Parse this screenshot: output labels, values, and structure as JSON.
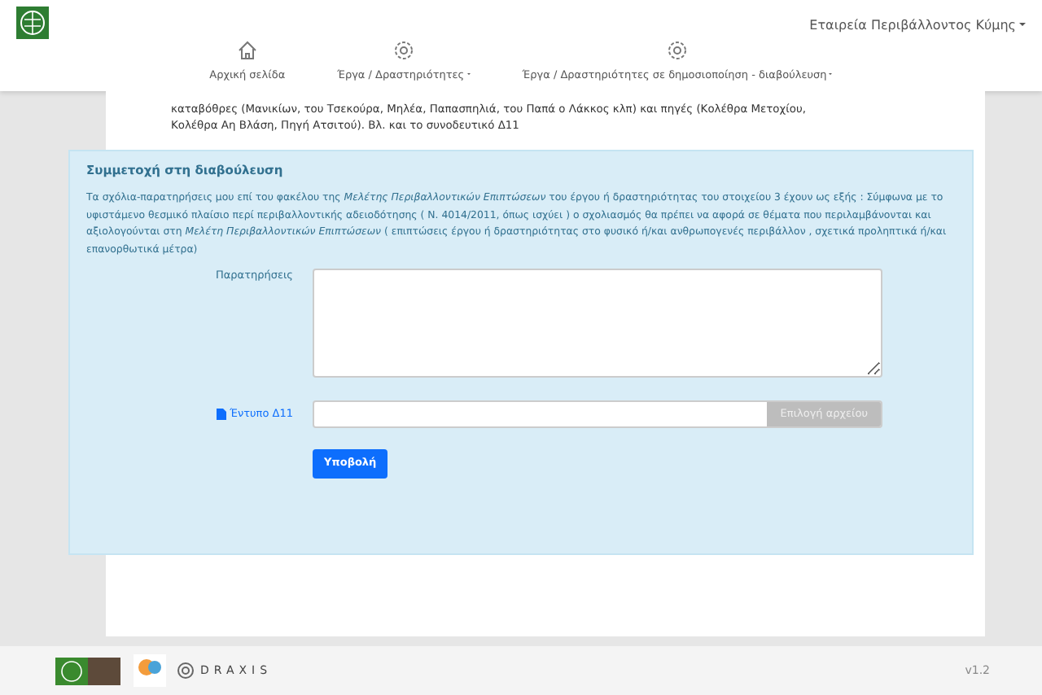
{
  "header": {
    "company_menu": "Εταιρεία Περιβάλλοντος Κύμης"
  },
  "nav": [
    {
      "label": "Αρχική σελίδα",
      "kind": "home",
      "dropdown": false
    },
    {
      "label": "Έργα / Δραστηριότητες",
      "kind": "gear",
      "dropdown": true
    },
    {
      "label": "Έργα / Δραστηριότητες σε δημοσιοποίηση - διαβούλευση",
      "kind": "gear",
      "dropdown": true
    }
  ],
  "description": [
    "καταβόθρες (Μανικίων, του Τσεκούρα, Μηλέα, Παπασπηλιά, του Παπά ο Λάκκος κλπ) και πηγές (Κολέθρα Μετοχίου,",
    "Κολέθρα Αη Βλάση, Πηγή Ατσιτού). Βλ. και το συνοδευτικό Δ11"
  ],
  "consultation": {
    "title": "Συμμετοχή στη διαβούλευση",
    "intro": "Τα σχόλια-παρατηρήσεις μου επί του φακέλου της *Μελέτης Περιβαλλοντικών Επιπτώσεων* του έργου ή δραστηριότητας του στοιχείου 3 έχουν ως εξής : Σύμφωνα με το υφιστάμενο θεσμικό πλαίσιο περί περιβαλλοντικής αδειοδότησης ( Ν. 4014/2011, όπως ισχύει ) ο σχολιασμός θα πρέπει να αφορά σε θέματα που περιλαμβάνονται και αξιολογούνται στη *Μελέτη Περιβαλλοντικών Επιπτώσεων* ( επιπτώσεις έργου ή δραστηριότητας στο φυσικό ή/και ανθρωπογενές περιβάλλον , σχετικά προληπτικά ή/και επανορθωτικά μέτρα)",
    "comments_label": "Παρατηρήσεις",
    "file_label": "Έντυπο Δ11",
    "file_button": "Επιλογή αρχείου",
    "file_button_disabled": true,
    "submit": "Υποβολή"
  },
  "footer": {
    "version": "v1.2",
    "brand": "DRAXIS"
  }
}
